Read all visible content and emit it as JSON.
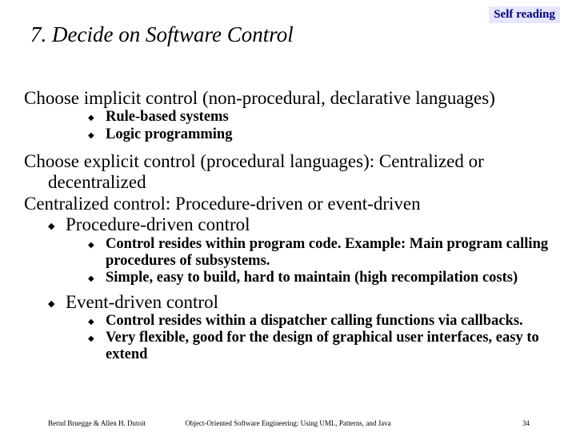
{
  "badge": "Self reading",
  "title": "7. Decide on Software Control",
  "lines": {
    "implicit": "Choose implicit  control (non-procedural, declarative languages)",
    "implicit_sub1": "Rule-based systems",
    "implicit_sub2": "Logic programming",
    "explicit1": "Choose explicit control (procedural languages): Centralized or decentralized",
    "explicit2": "Centralized control: Procedure-driven or event-driven",
    "proc": "Procedure-driven control",
    "proc_sub1": "Control resides within program code. Example: Main program calling procedures of subsystems.",
    "proc_sub2": "Simple, easy to build, hard to maintain (high recompilation costs)",
    "event": "Event-driven control",
    "event_sub1": "Control resides within a dispatcher calling functions via callbacks.",
    "event_sub2": "Very flexible, good for the design of graphical user interfaces, easy to extend"
  },
  "footer": {
    "left": "Bernd Bruegge & Allen H. Dutoit",
    "center": "Object-Oriented Software Engineering: Using UML, Patterns, and Java",
    "right": "34"
  }
}
